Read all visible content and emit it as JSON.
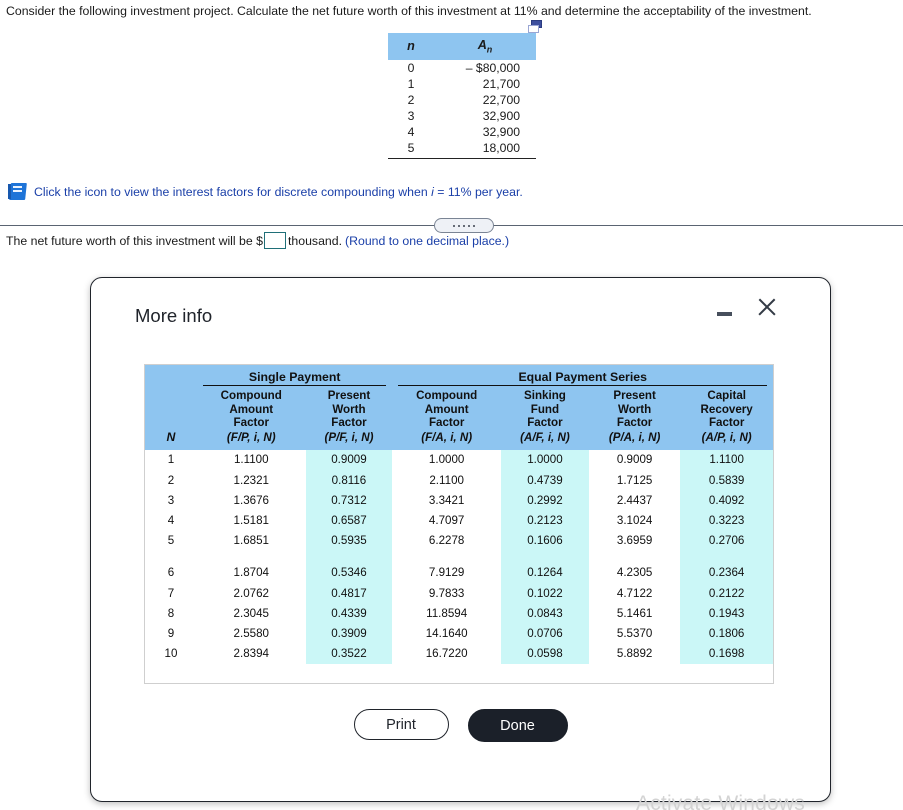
{
  "question": {
    "text": "Consider the following investment project. Calculate the net future worth of this investment at 11% and determine the acceptability of the investment."
  },
  "popout_icon": {
    "name": "popout-window-icon"
  },
  "cash_flow_table": {
    "headers": {
      "n": "n",
      "a_main": "A",
      "a_sub": "n"
    },
    "rows": [
      {
        "n": "0",
        "amount": "– $80,000"
      },
      {
        "n": "1",
        "amount": "21,700"
      },
      {
        "n": "2",
        "amount": "22,700"
      },
      {
        "n": "3",
        "amount": "32,900"
      },
      {
        "n": "4",
        "amount": "32,900"
      },
      {
        "n": "5",
        "amount": "18,000"
      }
    ]
  },
  "book_link": {
    "icon": "book-icon",
    "text_before": "Click the icon to view the interest factors for discrete compounding when ",
    "italic_i": "i",
    "text_after": " = 11% per year."
  },
  "divider": {
    "handle_dots": 5
  },
  "answer": {
    "prefix": "The net future worth of this investment will be $",
    "input_value": "",
    "input_placeholder": "",
    "suffix": "thousand.",
    "note": "(Round to one decimal place.)"
  },
  "modal": {
    "title": "More info",
    "minimize_icon": "minimize-icon",
    "close_icon": "close-icon",
    "buttons": {
      "print": "Print",
      "done": "Done"
    },
    "factor_table": {
      "group_headers": [
        {
          "label": "",
          "span": 1
        },
        {
          "label": "Single Payment",
          "span": 2
        },
        {
          "label": "Equal Payment Series",
          "span": 4
        }
      ],
      "columns": [
        {
          "title": "N",
          "formula": ""
        },
        {
          "title": "Compound Amount Factor",
          "lines": [
            "Compound",
            "Amount",
            "Factor"
          ],
          "formula": "(F/P, i, N)"
        },
        {
          "title": "Present Worth Factor",
          "lines": [
            "Present",
            "Worth",
            "Factor"
          ],
          "formula": "(P/F, i, N)"
        },
        {
          "title": "Compound Amount Factor",
          "lines": [
            "Compound",
            "Amount",
            "Factor"
          ],
          "formula": "(F/A, i, N)"
        },
        {
          "title": "Sinking Fund Factor",
          "lines": [
            "Sinking",
            "Fund",
            "Factor"
          ],
          "formula": "(A/F, i, N)"
        },
        {
          "title": "Present Worth Factor",
          "lines": [
            "Present",
            "Worth",
            "Factor"
          ],
          "formula": "(P/A, i, N)"
        },
        {
          "title": "Capital Recovery Factor",
          "lines": [
            "Capital",
            "Recovery",
            "Factor"
          ],
          "formula": "(A/P, i, N)"
        }
      ],
      "rows": [
        {
          "N": "1",
          "FP": "1.1100",
          "PF": "0.9009",
          "FA": "1.0000",
          "AF": "1.0000",
          "PA": "0.9009",
          "AP": "1.1100"
        },
        {
          "N": "2",
          "FP": "1.2321",
          "PF": "0.8116",
          "FA": "2.1100",
          "AF": "0.4739",
          "PA": "1.7125",
          "AP": "0.5839"
        },
        {
          "N": "3",
          "FP": "1.3676",
          "PF": "0.7312",
          "FA": "3.3421",
          "AF": "0.2992",
          "PA": "2.4437",
          "AP": "0.4092"
        },
        {
          "N": "4",
          "FP": "1.5181",
          "PF": "0.6587",
          "FA": "4.7097",
          "AF": "0.2123",
          "PA": "3.1024",
          "AP": "0.3223"
        },
        {
          "N": "5",
          "FP": "1.6851",
          "PF": "0.5935",
          "FA": "6.2278",
          "AF": "0.1606",
          "PA": "3.6959",
          "AP": "0.2706"
        },
        {
          "N": "6",
          "FP": "1.8704",
          "PF": "0.5346",
          "FA": "7.9129",
          "AF": "0.1264",
          "PA": "4.2305",
          "AP": "0.2364"
        },
        {
          "N": "7",
          "FP": "2.0762",
          "PF": "0.4817",
          "FA": "9.7833",
          "AF": "0.1022",
          "PA": "4.7122",
          "AP": "0.2122"
        },
        {
          "N": "8",
          "FP": "2.3045",
          "PF": "0.4339",
          "FA": "11.8594",
          "AF": "0.0843",
          "PA": "5.1461",
          "AP": "0.1943"
        },
        {
          "N": "9",
          "FP": "2.5580",
          "PF": "0.3909",
          "FA": "14.1640",
          "AF": "0.0706",
          "PA": "5.5370",
          "AP": "0.1806"
        },
        {
          "N": "10",
          "FP": "2.8394",
          "PF": "0.3522",
          "FA": "16.7220",
          "AF": "0.0598",
          "PA": "5.8892",
          "AP": "0.1698"
        }
      ],
      "gap_after_row_index": 4
    }
  },
  "watermark": {
    "text": "Activate Windows"
  },
  "colors": {
    "header_blue": "#8ec5f0",
    "highlight_cyan": "#cbf7f7",
    "link_blue": "#1a3fa8",
    "done_button": "#1b2029"
  }
}
